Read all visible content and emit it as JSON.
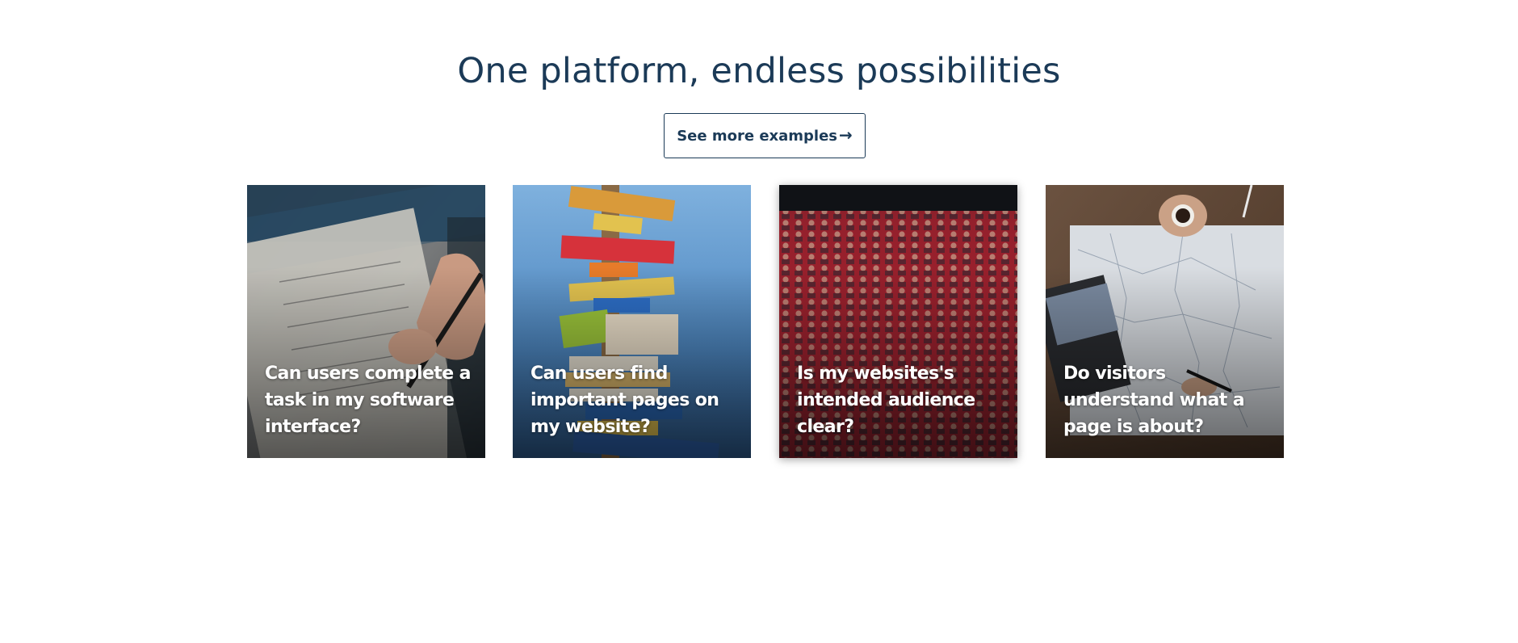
{
  "section": {
    "title": "One platform, endless possibilities",
    "cta_label": "See more examples",
    "cta_icon": "arrow-right-icon"
  },
  "cards": [
    {
      "caption": "Can users complete a task in my software interface?",
      "image": "hand-writing-checklist-photo"
    },
    {
      "caption": "Can users find important pages on my website?",
      "image": "colorful-direction-signpost-photo"
    },
    {
      "caption": "Is my websites's intended audience clear?",
      "image": "cinema-audience-red-seats-photo"
    },
    {
      "caption": "Do visitors understand what a page is about?",
      "image": "map-coffee-laptop-photo"
    }
  ],
  "colors": {
    "heading": "#1b3a57",
    "button_border": "#1b3a57",
    "caption_text": "#ffffff",
    "background": "#ffffff"
  }
}
